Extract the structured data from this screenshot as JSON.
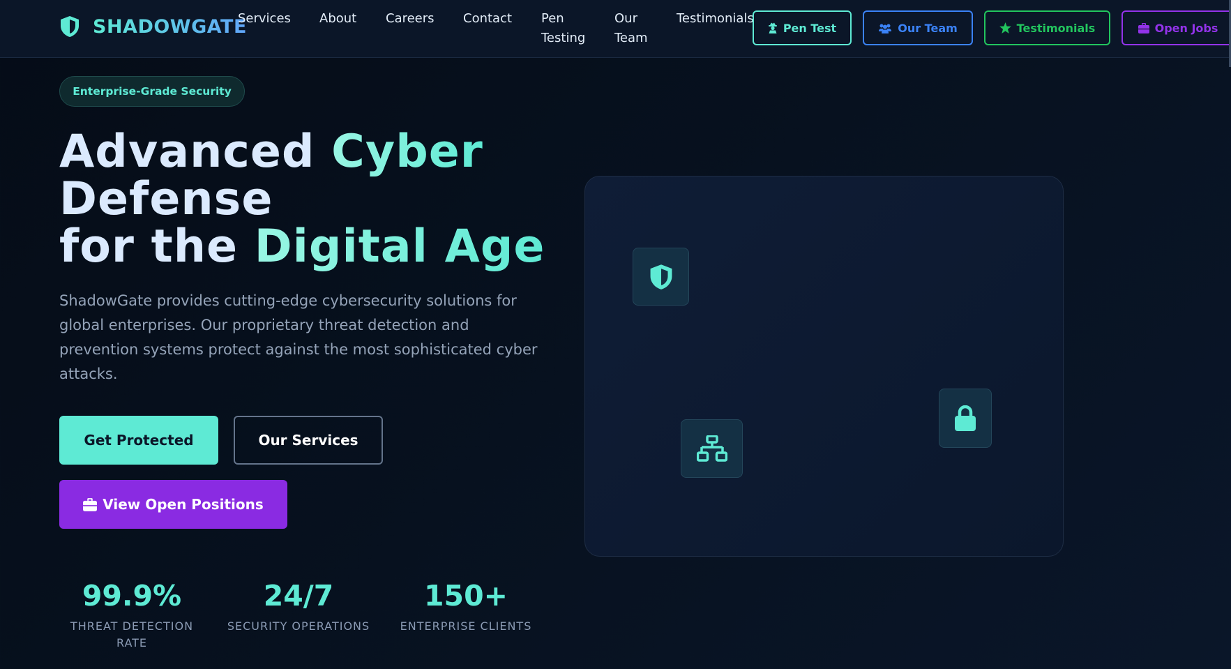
{
  "brand": {
    "name": "SHADOWGATE",
    "icon": "shield-icon"
  },
  "nav": {
    "links": [
      "Services",
      "About",
      "Careers",
      "Contact",
      "Pen Testing",
      "Our Team",
      "Testimonials"
    ],
    "buttons": [
      {
        "label": "Pen Test",
        "icon": "user-secret-icon",
        "color": "#5eead4"
      },
      {
        "label": "Our Team",
        "icon": "users-icon",
        "color": "#3b82f6"
      },
      {
        "label": "Testimonials",
        "icon": "star-icon",
        "color": "#22c55e"
      },
      {
        "label": "Open Jobs",
        "icon": "briefcase-icon",
        "color": "#9333ea"
      }
    ]
  },
  "hero": {
    "badge": "Enterprise-Grade Security",
    "headline": {
      "line1_a": "Advanced ",
      "line1_b": "Cyber",
      "line2": "Defense",
      "line3_a": "for the ",
      "line3_b": "Digital Age"
    },
    "description": "ShadowGate provides cutting-edge cybersecurity solutions for global enterprises. Our proprietary threat detection and prevention systems protect against the most sophisticated cyber attacks.",
    "buttons": {
      "primary": "Get Protected",
      "secondary": "Our Services",
      "positions": "View Open Positions"
    },
    "stats": [
      {
        "value": "99.9%",
        "label": "THREAT DETECTION RATE"
      },
      {
        "value": "24/7",
        "label": "SECURITY OPERATIONS"
      },
      {
        "value": "150+",
        "label": "ENTERPRISE CLIENTS"
      }
    ]
  },
  "visual": {
    "icons": [
      "shield-icon",
      "network-icon",
      "lock-icon"
    ]
  },
  "colors": {
    "accent": "#5eead4",
    "purple": "#8a2be2",
    "background": "#050c17"
  }
}
